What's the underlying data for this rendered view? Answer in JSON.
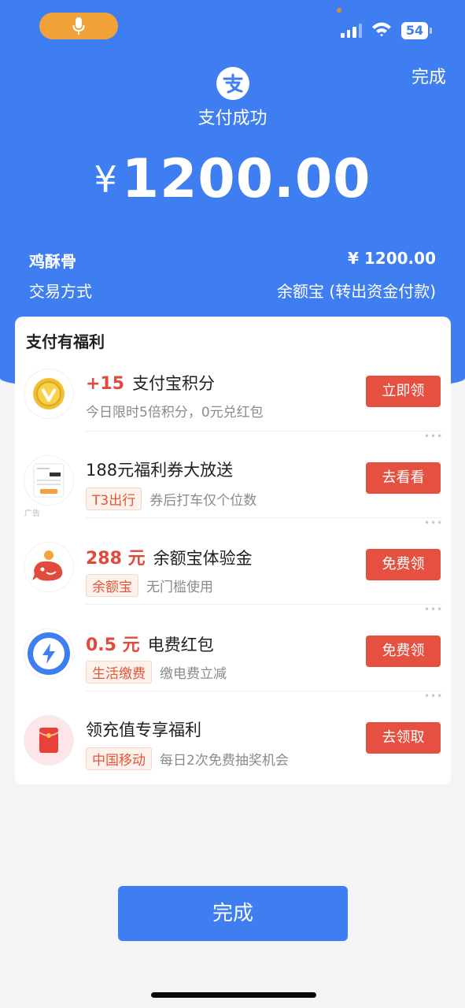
{
  "status_bar": {
    "battery": "54"
  },
  "header": {
    "done_label": "完成",
    "title": "支付成功",
    "currency_symbol": "¥",
    "amount": "1200.00"
  },
  "order": {
    "merchant": "鸡酥骨",
    "merchant_amount": "¥ 1200.00",
    "method_label": "交易方式",
    "method_value": "余额宝 (转出资金付款)"
  },
  "benefits": {
    "title": "支付有福利",
    "items": [
      {
        "highlight": "+15",
        "title": "支付宝积分",
        "tag": "",
        "desc": "今日限时5倍积分，0元兑红包",
        "button": "立即领",
        "icon": "points-coin-icon"
      },
      {
        "highlight": "",
        "title": "188元福利券大放送",
        "tag": "T3出行",
        "desc": "券后打车仅个位数",
        "button": "去看看",
        "icon": "t3-travel-app-icon",
        "ad": "广告"
      },
      {
        "highlight": "288 元",
        "title": "余额宝体验金",
        "tag": "余额宝",
        "desc": "无门槛使用",
        "button": "免费领",
        "icon": "yuebao-whale-icon"
      },
      {
        "highlight": "0.5 元",
        "title": "电费红包",
        "tag": "生活缴费",
        "desc": "缴电费立减",
        "button": "免费领",
        "icon": "electricity-bolt-icon"
      },
      {
        "highlight": "",
        "title": "领充值专享福利",
        "tag": "中国移动",
        "desc": "每日2次免费抽奖机会",
        "button": "去领取",
        "icon": "red-envelope-icon"
      }
    ]
  },
  "footer": {
    "done_button": "完成"
  },
  "colors": {
    "primary_blue": "#3f7ef1",
    "accent_red": "#e65040",
    "mic_orange": "#f1a33a"
  }
}
